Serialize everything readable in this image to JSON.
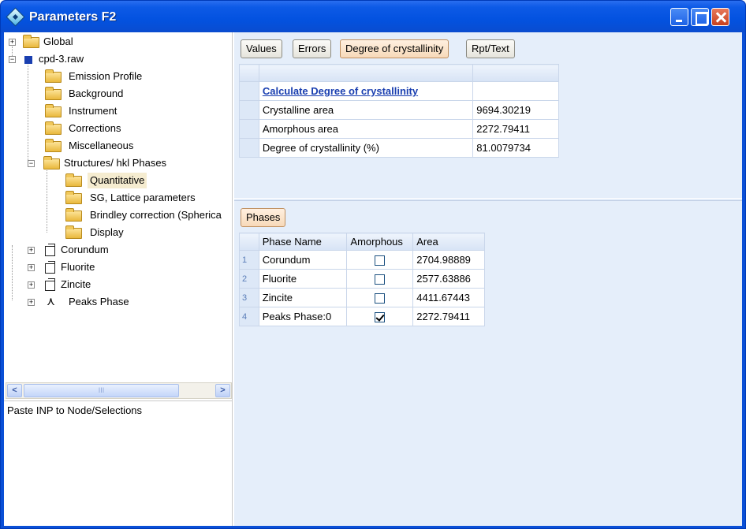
{
  "window": {
    "title": "Parameters F2"
  },
  "tree": {
    "items": [
      {
        "label": "Global"
      },
      {
        "label": "cpd-3.raw"
      },
      {
        "label": "Emission Profile"
      },
      {
        "label": "Background"
      },
      {
        "label": "Instrument"
      },
      {
        "label": "Corrections"
      },
      {
        "label": "Miscellaneous"
      },
      {
        "label": "Structures/ hkl Phases"
      },
      {
        "label": "Quantitative"
      },
      {
        "label": "SG, Lattice parameters"
      },
      {
        "label": "Brindley correction (Spherica"
      },
      {
        "label": "Display"
      },
      {
        "label": "Corundum"
      },
      {
        "label": "Fluorite"
      },
      {
        "label": "Zincite"
      },
      {
        "label": "Peaks Phase"
      }
    ]
  },
  "scrollbar": {
    "thumb_grip": "III"
  },
  "paste_area": {
    "text": "Paste INP to Node/Selections"
  },
  "tabs": {
    "values": "Values",
    "errors": "Errors",
    "degree": "Degree of crystallinity",
    "rpt": "Rpt/Text"
  },
  "crystallinity": {
    "calc_link": "Calculate Degree of crystallinity",
    "rows": [
      {
        "label": "Crystalline area",
        "value": "9694.30219"
      },
      {
        "label": "Amorphous area",
        "value": "2272.79411"
      },
      {
        "label": "Degree of crystallinity (%)",
        "value": "81.0079734"
      }
    ]
  },
  "phases": {
    "button": "Phases",
    "headers": {
      "name": "Phase Name",
      "amorphous": "Amorphous",
      "area": "Area"
    },
    "rows": [
      {
        "num": "1",
        "name": "Corundum",
        "amorphous": false,
        "area": "2704.98889"
      },
      {
        "num": "2",
        "name": "Fluorite",
        "amorphous": false,
        "area": "2577.63886"
      },
      {
        "num": "3",
        "name": "Zincite",
        "amorphous": false,
        "area": "4411.67443"
      },
      {
        "num": "4",
        "name": "Peaks Phase:0",
        "amorphous": true,
        "area": "2272.79411"
      }
    ]
  }
}
